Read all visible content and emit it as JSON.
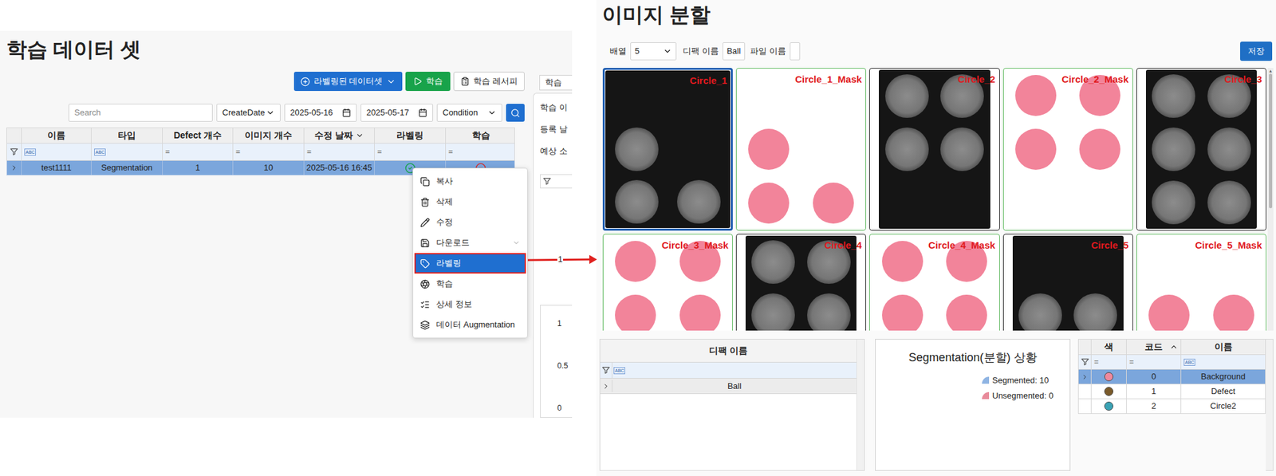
{
  "left": {
    "title": "학습 데이터 셋",
    "toolbar": [
      {
        "label": "라벨링된 데이터셋",
        "kind": "dropdown"
      },
      {
        "label": "학습",
        "kind": "run"
      },
      {
        "label": "학습 레서피",
        "kind": "recipe"
      }
    ],
    "search": {
      "placeholder": "Search",
      "sort": "CreateDate",
      "date_from": "2025-05-16",
      "date_to": "2025-05-17",
      "condition": "Condition"
    },
    "table": {
      "columns": [
        {
          "label": "이름",
          "sorted": false
        },
        {
          "label": "타입",
          "sorted": false
        },
        {
          "label": "Defect 개수",
          "sorted": false
        },
        {
          "label": "이미지 개수",
          "sorted": false
        },
        {
          "label": "수정 날짜",
          "sorted": true
        },
        {
          "label": "라벨링",
          "sorted": false
        },
        {
          "label": "학습",
          "sorted": false
        }
      ],
      "filters": [
        "ABC",
        "ABC",
        "=",
        "=",
        "=",
        "=",
        "="
      ],
      "rows": [
        {
          "cells": [
            "test1111",
            "Segmentation",
            "1",
            "10",
            "2025-05-16 16:45"
          ],
          "labeled": true,
          "trained": false,
          "selected": true,
          "expanded": false
        }
      ]
    },
    "side_panel": {
      "tab": "학습",
      "labels": [
        "학습 이",
        "등록 날",
        "예상 소"
      ],
      "ticks": [
        "1",
        "0.5",
        "0"
      ]
    },
    "context_menu": [
      {
        "label": "복사",
        "selected": false,
        "submenu": false
      },
      {
        "label": "삭제",
        "selected": false,
        "submenu": false
      },
      {
        "label": "수정",
        "selected": false,
        "submenu": false
      },
      {
        "label": "다운로드",
        "selected": false,
        "submenu": true
      },
      {
        "label": "라벨링",
        "selected": true,
        "submenu": false
      },
      {
        "label": "학습",
        "selected": false,
        "submenu": false
      },
      {
        "label": "상세 정보",
        "selected": false,
        "submenu": false
      },
      {
        "label": "데이터 Augmentation",
        "selected": false,
        "submenu": false
      }
    ]
  },
  "arrow_label": "1",
  "right": {
    "title": "이미지 분할",
    "toolbar": {
      "layout_label": "배열",
      "layout_value": "5",
      "defect_label": "디팩 이름",
      "defect_value": "Ball",
      "file_label": "파일 이름",
      "file_value": "",
      "save": "저장"
    },
    "tiles": [
      {
        "label": "Circle_1",
        "kind": "image",
        "selected": true,
        "spots": [
          2,
          4,
          5
        ]
      },
      {
        "label": "Circle_1_Mask",
        "kind": "mask",
        "selected": false,
        "spots": [
          2,
          4,
          5
        ]
      },
      {
        "label": "Circle_2",
        "kind": "image",
        "selected": false,
        "spots": [
          0,
          1,
          2,
          3
        ]
      },
      {
        "label": "Circle_2_Mask",
        "kind": "mask",
        "selected": false,
        "spots": [
          0,
          1,
          2,
          3
        ]
      },
      {
        "label": "Circle_3",
        "kind": "image",
        "selected": false,
        "spots": [
          0,
          1,
          2,
          3,
          4,
          5
        ]
      },
      {
        "label": "Circle_3_Mask",
        "kind": "mask",
        "selected": false,
        "spots": [
          0,
          1,
          2,
          3,
          4,
          5
        ]
      },
      {
        "label": "Circle_4",
        "kind": "image",
        "selected": false,
        "spots": [
          0,
          1,
          2,
          3
        ]
      },
      {
        "label": "Circle_4_Mask",
        "kind": "mask",
        "selected": false,
        "spots": [
          0,
          1,
          2,
          3
        ]
      },
      {
        "label": "Circle_5",
        "kind": "image",
        "selected": false,
        "spots": [
          2,
          3
        ]
      },
      {
        "label": "Circle_5_Mask",
        "kind": "mask",
        "selected": false,
        "spots": [
          2,
          3
        ]
      }
    ],
    "defect_table": {
      "column": "디팩 이름",
      "filter": "ABC",
      "rows": [
        {
          "name": "Ball",
          "selected": false,
          "expanded": false
        }
      ]
    },
    "chart": {
      "title": "Segmentation(분할) 상황",
      "legend": [
        {
          "label": "Segmented: 10",
          "color": "#8fb4e3"
        },
        {
          "label": "Unsegmented: 0",
          "color": "#e88a9a"
        }
      ]
    },
    "class_table": {
      "columns": [
        {
          "label": "색",
          "sorted": false
        },
        {
          "label": "코드",
          "sorted": true
        },
        {
          "label": "이름",
          "sorted": false
        }
      ],
      "filters": [
        "=",
        "=",
        "ABC"
      ],
      "rows": [
        {
          "code": "0",
          "name": "Background",
          "color": "#f0899e",
          "selected": true
        },
        {
          "code": "1",
          "name": "Defect",
          "color": "#7a5a2a",
          "selected": false
        },
        {
          "code": "2",
          "name": "Circle2",
          "color": "#3aa3b5",
          "selected": false
        }
      ]
    }
  }
}
